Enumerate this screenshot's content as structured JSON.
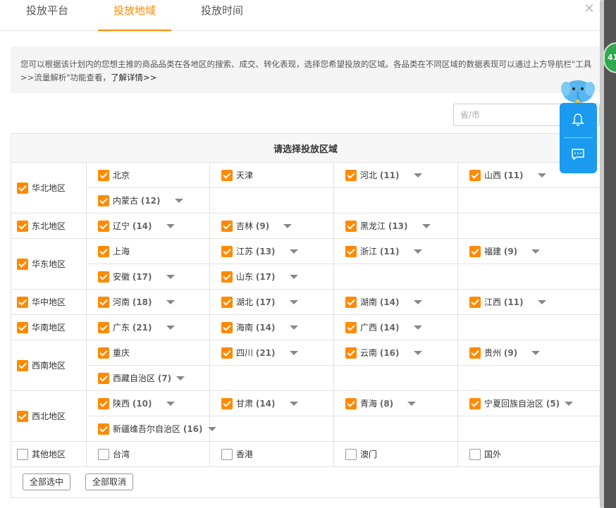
{
  "tabs": [
    {
      "label": "投放平台",
      "active": false
    },
    {
      "label": "投放地域",
      "active": true
    },
    {
      "label": "投放时间",
      "active": false
    }
  ],
  "close_icon": "close-icon",
  "info": {
    "text": "您可以根据该计划内的您想主推的商品品类在各地区的搜索、成交、转化表现，选择您希望投放的区域。各品类在不同区域的数据表现可以通过上方导航栏\"工具>>流量解析\"功能查看，",
    "more_link": "了解详情>>"
  },
  "search": {
    "placeholder": "省/市",
    "value": ""
  },
  "table_header": "请选择投放区域",
  "regions": [
    {
      "name": "华北地区",
      "checked": true,
      "rows": [
        [
          {
            "name": "北京",
            "count": "",
            "checked": true,
            "dropdown": false
          },
          {
            "name": "天津",
            "count": "",
            "checked": true,
            "dropdown": false
          },
          {
            "name": "河北",
            "count": "(11)",
            "checked": true,
            "dropdown": true
          },
          {
            "name": "山西",
            "count": "(11)",
            "checked": true,
            "dropdown": true
          }
        ],
        [
          {
            "name": "内蒙古",
            "count": "(12)",
            "checked": true,
            "dropdown": true
          }
        ]
      ]
    },
    {
      "name": "东北地区",
      "checked": true,
      "rows": [
        [
          {
            "name": "辽宁",
            "count": "(14)",
            "checked": true,
            "dropdown": true
          },
          {
            "name": "吉林",
            "count": "(9)",
            "checked": true,
            "dropdown": true
          },
          {
            "name": "黑龙江",
            "count": "(13)",
            "checked": true,
            "dropdown": true
          }
        ]
      ]
    },
    {
      "name": "华东地区",
      "checked": true,
      "rows": [
        [
          {
            "name": "上海",
            "count": "",
            "checked": true,
            "dropdown": false
          },
          {
            "name": "江苏",
            "count": "(13)",
            "checked": true,
            "dropdown": true
          },
          {
            "name": "浙江",
            "count": "(11)",
            "checked": true,
            "dropdown": true
          },
          {
            "name": "福建",
            "count": "(9)",
            "checked": true,
            "dropdown": true
          }
        ],
        [
          {
            "name": "安徽",
            "count": "(17)",
            "checked": true,
            "dropdown": true
          },
          {
            "name": "山东",
            "count": "(17)",
            "checked": true,
            "dropdown": true
          }
        ]
      ]
    },
    {
      "name": "华中地区",
      "checked": true,
      "rows": [
        [
          {
            "name": "河南",
            "count": "(18)",
            "checked": true,
            "dropdown": true
          },
          {
            "name": "湖北",
            "count": "(17)",
            "checked": true,
            "dropdown": true
          },
          {
            "name": "湖南",
            "count": "(14)",
            "checked": true,
            "dropdown": true
          },
          {
            "name": "江西",
            "count": "(11)",
            "checked": true,
            "dropdown": true
          }
        ]
      ]
    },
    {
      "name": "华南地区",
      "checked": true,
      "rows": [
        [
          {
            "name": "广东",
            "count": "(21)",
            "checked": true,
            "dropdown": true
          },
          {
            "name": "海南",
            "count": "(14)",
            "checked": true,
            "dropdown": true
          },
          {
            "name": "广西",
            "count": "(14)",
            "checked": true,
            "dropdown": true
          }
        ]
      ]
    },
    {
      "name": "西南地区",
      "checked": true,
      "rows": [
        [
          {
            "name": "重庆",
            "count": "",
            "checked": true,
            "dropdown": false
          },
          {
            "name": "四川",
            "count": "(21)",
            "checked": true,
            "dropdown": true
          },
          {
            "name": "云南",
            "count": "(16)",
            "checked": true,
            "dropdown": true
          },
          {
            "name": "贵州",
            "count": "(9)",
            "checked": true,
            "dropdown": true
          }
        ],
        [
          {
            "name": "西藏自治区",
            "count": "(7)",
            "checked": true,
            "dropdown": true
          }
        ]
      ]
    },
    {
      "name": "西北地区",
      "checked": true,
      "rows": [
        [
          {
            "name": "陕西",
            "count": "(10)",
            "checked": true,
            "dropdown": true
          },
          {
            "name": "甘肃",
            "count": "(14)",
            "checked": true,
            "dropdown": true
          },
          {
            "name": "青海",
            "count": "(8)",
            "checked": true,
            "dropdown": true
          },
          {
            "name": "宁夏回族自治区",
            "count": "(5)",
            "checked": true,
            "dropdown": true
          }
        ],
        [
          {
            "name": "新疆维吾尔自治区",
            "count": "(16)",
            "checked": true,
            "dropdown": true
          }
        ]
      ]
    },
    {
      "name": "其他地区",
      "checked": false,
      "rows": [
        [
          {
            "name": "台湾",
            "count": "",
            "checked": false,
            "dropdown": false
          },
          {
            "name": "香港",
            "count": "",
            "checked": false,
            "dropdown": false
          },
          {
            "name": "澳门",
            "count": "",
            "checked": false,
            "dropdown": false
          },
          {
            "name": "国外",
            "count": "",
            "checked": false,
            "dropdown": false
          }
        ]
      ]
    }
  ],
  "buttons": {
    "select_all": "全部选中",
    "deselect_all": "全部取消"
  },
  "badge": {
    "text": "41"
  },
  "float_panel": {
    "icons": [
      "bell-icon",
      "chat-icon"
    ]
  },
  "colors": {
    "accent": "#ff8a00",
    "panel_blue": "#1a9bf0",
    "badge_green": "#2fa84f"
  }
}
